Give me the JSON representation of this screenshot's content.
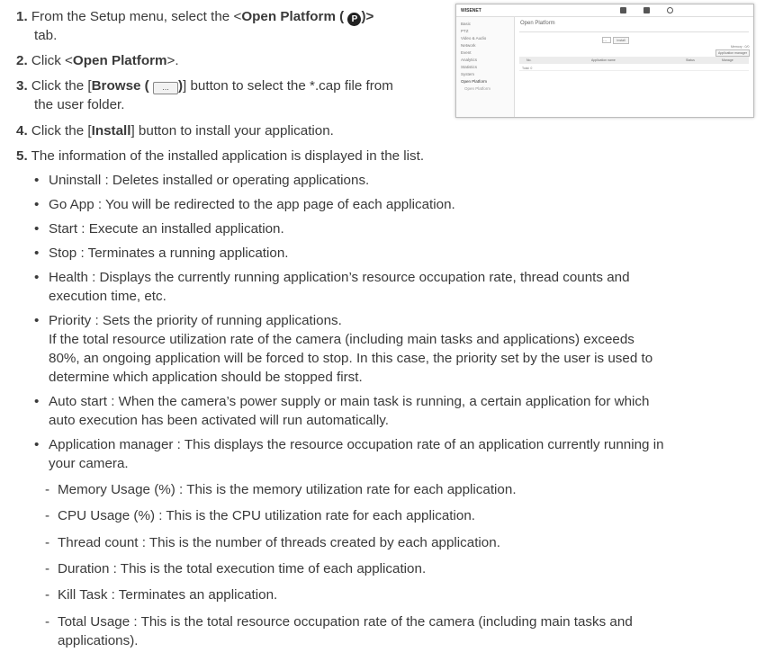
{
  "steps": [
    {
      "num": "1.",
      "a": "From the Setup menu, select the <",
      "bold": "Open Platform (",
      "b": ")>",
      "cont": "tab."
    },
    {
      "num": "2.",
      "a": "Click <",
      "bold": "Open Platform",
      "b": ">."
    },
    {
      "num": "3.",
      "a": "Click the [",
      "bold": "Browse (",
      "bold2": ")",
      "b": "] button to select the *.cap file from",
      "cont": "the user folder."
    },
    {
      "num": "4.",
      "a": "Click the [",
      "bold": "Install",
      "b": "] button to install your application."
    },
    {
      "num": "5.",
      "a": "The information of the installed application is displayed in the list."
    }
  ],
  "icons": {
    "platform_letter": "P",
    "browse_glyph": "..."
  },
  "bullets": [
    "Uninstall : Deletes installed or operating applications.",
    "Go App : You will be redirected to the app page of each application.",
    "Start : Execute an installed application.",
    "Stop : Terminates a running application.",
    "Health : Displays the currently running application’s resource occupation rate, thread counts and",
    "Priority : Sets the priority of running applications.",
    "Auto start : When the camera’s power supply or main task is running, a certain application for which",
    "Application manager : This displays the resource occupation rate of an application currently running in"
  ],
  "continuations": {
    "health": "execution time, etc.",
    "priority_1": "If the total resource utilization rate of the camera (including main tasks and applications) exceeds",
    "priority_2": "80%, an ongoing application will be forced to stop. In this case, the priority set by the user is used to",
    "priority_3": "determine which application should be stopped first.",
    "auto_start": "auto execution has been activated will run automatically.",
    "app_manager": "your camera.",
    "total_usage": "applications)."
  },
  "sub_items": [
    "Memory Usage (%) : This is the memory utilization rate for each application.",
    "CPU Usage (%) : This is the CPU utilization rate for each application.",
    "Thread count : This is the number of threads created by each application.",
    "Duration : This is the total execution time of each application.",
    "Kill Task : Terminates an application.",
    "Total Usage : This is the total resource occupation rate of the camera (including main tasks and"
  ],
  "screenshot": {
    "logo": "WISENET",
    "title": "Open Platform",
    "sidebar": [
      "Basic",
      "PTZ",
      "Video & Audio",
      "Network",
      "Event",
      "Analytics",
      "Statistics",
      "System",
      "Open Platform",
      "Open Platform"
    ],
    "install_label": "Install",
    "browse_label": "...",
    "memory_text": "Memory : 0/0",
    "manager_button": "Application manager",
    "table_headers": [
      "No.",
      "Application name",
      "Status",
      "Manage"
    ],
    "row": "Total: 0"
  }
}
